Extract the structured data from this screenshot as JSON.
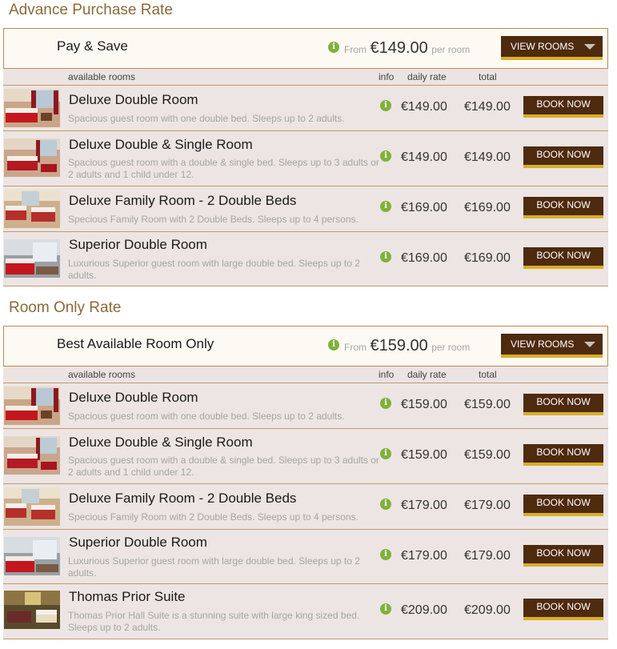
{
  "sections": [
    {
      "title": "Advance Purchase Rate",
      "rate_name": "Pay & Save",
      "from_label": "From",
      "from_price": "€149.00",
      "per_room": "per room",
      "view_button": "VIEW ROOMS",
      "columns": {
        "rooms": "available rooms",
        "info": "info",
        "daily": "daily rate",
        "total": "total"
      },
      "rooms": [
        {
          "name": "Deluxe Double Room",
          "desc": "Spacious guest room with one double bed. Sleeps up to 2 adults.",
          "daily": "€149.00",
          "total": "€149.00",
          "book": "BOOK NOW",
          "image": "deluxe-double-room-photo"
        },
        {
          "name": "Deluxe Double & Single Room",
          "desc": "Spacious guest room with a double & single bed. Sleeps up to 3 adults or 2 adults and 1 child under 12.",
          "daily": "€149.00",
          "total": "€149.00",
          "book": "BOOK NOW",
          "image": "deluxe-double-single-room-photo"
        },
        {
          "name": "Deluxe Family Room - 2 Double Beds",
          "desc": "Specious Family Room with 2 Double Beds. Sleeps up to 4 persons.",
          "daily": "€169.00",
          "total": "€169.00",
          "book": "BOOK NOW",
          "image": "family-room-photo"
        },
        {
          "name": "Superior Double Room",
          "desc": "Luxurious Superior guest room with large double bed. Sleeps up to 2 adults.",
          "daily": "€169.00",
          "total": "€169.00",
          "book": "BOOK NOW",
          "image": "superior-double-room-photo"
        }
      ]
    },
    {
      "title": "Room Only Rate",
      "rate_name": "Best Available Room Only",
      "from_label": "From",
      "from_price": "€159.00",
      "per_room": "per room",
      "view_button": "VIEW ROOMS",
      "columns": {
        "rooms": "available rooms",
        "info": "info",
        "daily": "daily rate",
        "total": "total"
      },
      "rooms": [
        {
          "name": "Deluxe Double Room",
          "desc": "Spacious guest room with one double bed. Sleeps up to 2 adults.",
          "daily": "€159.00",
          "total": "€159.00",
          "book": "BOOK NOW",
          "image": "deluxe-double-room-photo"
        },
        {
          "name": "Deluxe Double & Single Room",
          "desc": "Spacious guest room with a double & single bed. Sleeps up to 3 adults or 2 adults and 1 child under 12.",
          "daily": "€159.00",
          "total": "€159.00",
          "book": "BOOK NOW",
          "image": "deluxe-double-single-room-photo"
        },
        {
          "name": "Deluxe Family Room - 2 Double Beds",
          "desc": "Specious Family Room with 2 Double Beds. Sleeps up to 4 persons.",
          "daily": "€179.00",
          "total": "€179.00",
          "book": "BOOK NOW",
          "image": "family-room-photo"
        },
        {
          "name": "Superior Double Room",
          "desc": "Luxurious Superior guest room with large double bed. Sleeps up to 2 adults.",
          "daily": "€179.00",
          "total": "€179.00",
          "book": "BOOK NOW",
          "image": "superior-double-room-photo"
        },
        {
          "name": "Thomas Prior Suite",
          "desc": "Thomas Prior Hall Suite is a stunning suite with large king sized bed. Sleeps up to 2 adults.",
          "daily": "€209.00",
          "total": "€209.00",
          "book": "BOOK NOW",
          "image": "suite-photo"
        }
      ]
    }
  ],
  "icons": {
    "info": "info-icon",
    "dropdown": "chevron-down-icon"
  },
  "colors": {
    "brand_button": "#4e2a0e",
    "button_underline": "#d8ae2a",
    "section_title": "#8a6a38",
    "info_green": "#7db33a",
    "row_bg": "#ece5e3"
  }
}
